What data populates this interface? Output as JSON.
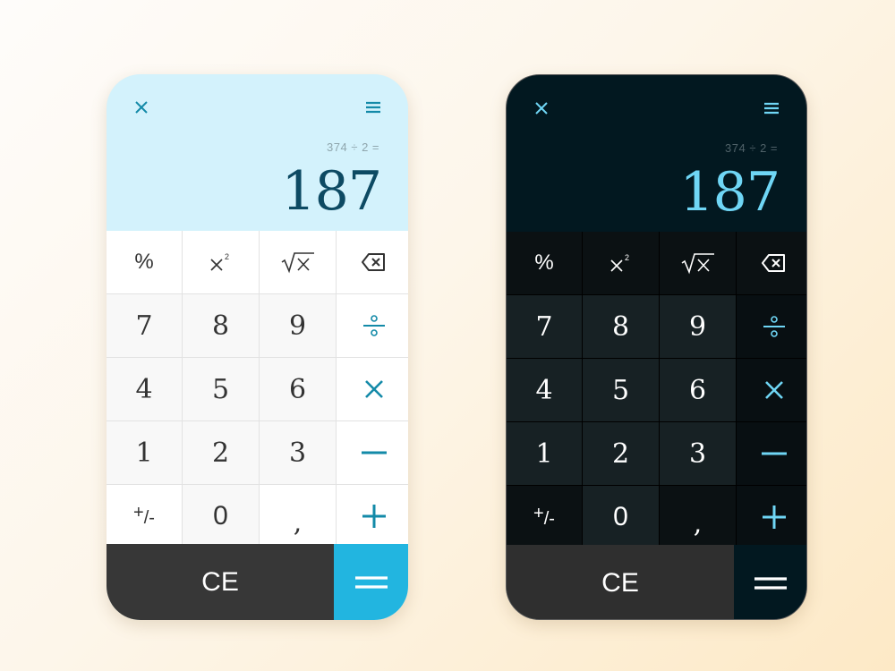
{
  "calculators": [
    {
      "theme": "light",
      "header": {
        "close_icon": "close-icon",
        "menu_icon": "menu-icon"
      },
      "display": {
        "expression": "374 ÷ 2 =",
        "result": "187"
      },
      "keys": {
        "percent": "%",
        "square": "x²",
        "sqrt": "√x",
        "backspace": "backspace-icon",
        "seven": "7",
        "eight": "8",
        "nine": "9",
        "divide": "÷",
        "four": "4",
        "five": "5",
        "six": "6",
        "multiply": "×",
        "one": "1",
        "two": "2",
        "three": "3",
        "minus": "−",
        "plus_minus_plus": "+",
        "plus_minus_minus": "/-",
        "zero": "0",
        "comma": ",",
        "plus": "+",
        "clear": "CE",
        "equals": "="
      },
      "colors": {
        "display_bg": "#d3f2fc",
        "result": "#0d4a63",
        "accent": "#138aa8",
        "equals_bg": "#22b5e0",
        "clear_bg": "#373737"
      }
    },
    {
      "theme": "dark",
      "header": {
        "close_icon": "close-icon",
        "menu_icon": "menu-icon"
      },
      "display": {
        "expression": "374 ÷ 2 =",
        "result": "187"
      },
      "keys": {
        "percent": "%",
        "square": "x²",
        "sqrt": "√x",
        "backspace": "backspace-icon",
        "seven": "7",
        "eight": "8",
        "nine": "9",
        "divide": "÷",
        "four": "4",
        "five": "5",
        "six": "6",
        "multiply": "×",
        "one": "1",
        "two": "2",
        "three": "3",
        "minus": "−",
        "plus_minus_plus": "+",
        "plus_minus_minus": "/-",
        "zero": "0",
        "comma": ",",
        "plus": "+",
        "clear": "CE",
        "equals": "="
      },
      "colors": {
        "display_bg": "#021820",
        "result": "#6fd6f5",
        "accent": "#6fd6f5",
        "equals_bg": "#021820",
        "clear_bg": "#2f2f2f"
      }
    }
  ]
}
